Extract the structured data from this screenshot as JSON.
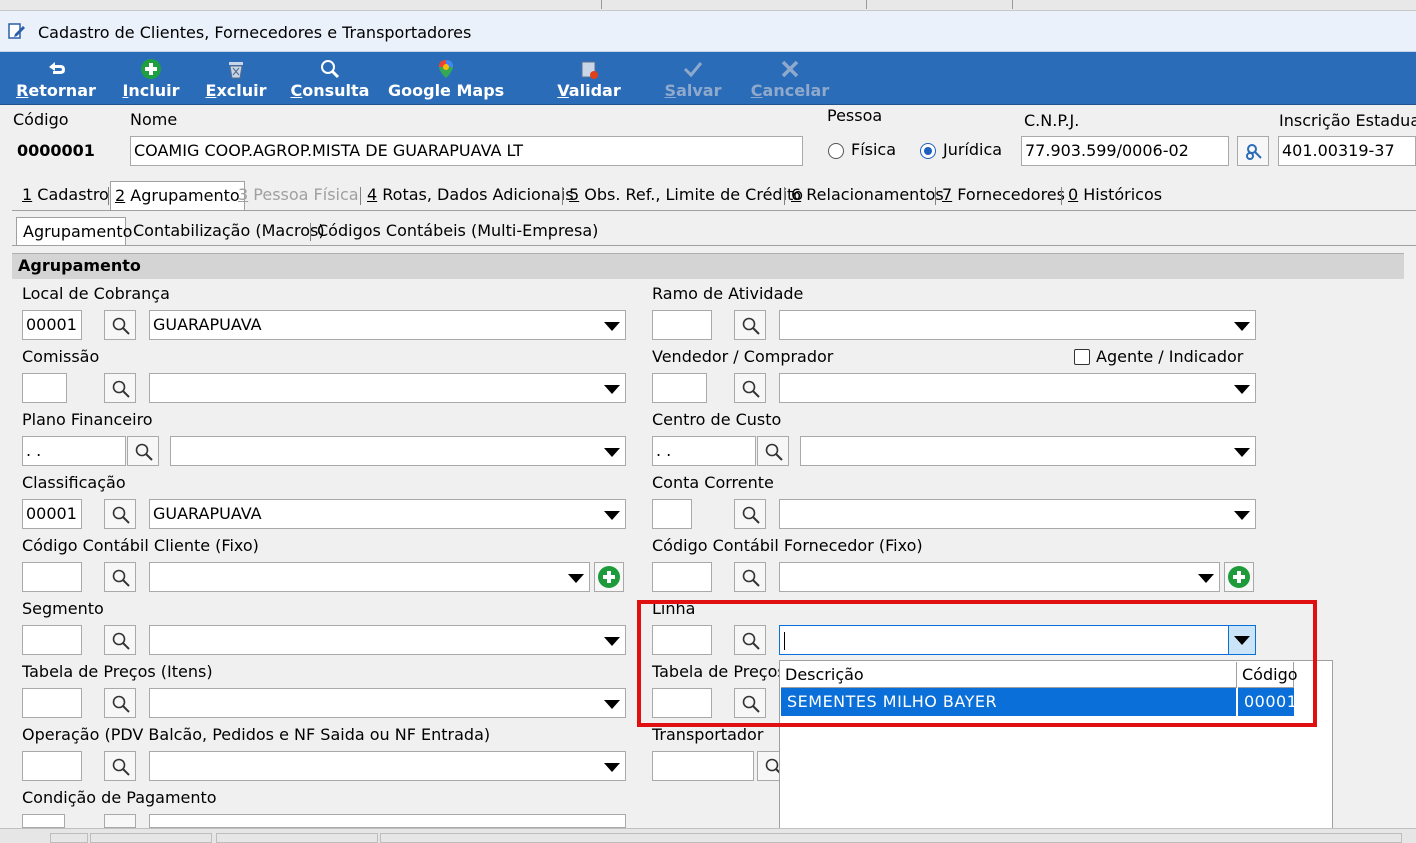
{
  "window": {
    "title": "Cadastro de Clientes, Fornecedores e Transportadores"
  },
  "toolbar": {
    "retornar": {
      "pre": "",
      "u": "R",
      "post": "etornar",
      "icon": "undo-arrow-icon"
    },
    "incluir": {
      "pre": "",
      "u": "I",
      "post": "ncluir",
      "icon": "plus-circle-icon"
    },
    "excluir": {
      "pre": "",
      "u": "E",
      "post": "xcluir",
      "icon": "trash-icon"
    },
    "consulta": {
      "pre": "",
      "u": "C",
      "post": "onsulta",
      "icon": "magnifier-icon"
    },
    "google_maps": {
      "pre": "Google Maps",
      "u": "",
      "post": "",
      "icon": "map-pin-icon"
    },
    "validar": {
      "pre": "",
      "u": "V",
      "post": "alidar",
      "icon": "validate-icon"
    },
    "salvar": {
      "pre": "",
      "u": "S",
      "post": "alvar",
      "icon": "checkmark-icon"
    },
    "cancelar": {
      "pre": "",
      "u": "C",
      "post": "ancelar",
      "icon": "x-icon"
    }
  },
  "header": {
    "codigo_label": "Código",
    "codigo_value": "0000001",
    "nome_label": "Nome",
    "nome_value": "COAMIG COOP.AGROP.MISTA DE GUARAPUAVA LT",
    "pessoa_label": "Pessoa",
    "fisica_label": "Física",
    "juridica_label": "Jurídica",
    "pessoa_selected": "Jurídica",
    "cnpj_label": "C.N.P.J.",
    "cnpj_value": "77.903.599/0006-02",
    "ie_label": "Inscrição Estadual",
    "ie_value": "401.00319-37"
  },
  "tabs": [
    {
      "u": "1",
      "rest": " Cadastro"
    },
    {
      "u": "2",
      "rest": " Agrupamento"
    },
    {
      "u": "3",
      "rest": " Pessoa Física"
    },
    {
      "u": "4",
      "rest": " Rotas, Dados Adicionais"
    },
    {
      "u": "5",
      "rest": " Obs. Ref., Limite de Crédito"
    },
    {
      "u": "6",
      "rest": " Relacionamentos"
    },
    {
      "u": "7",
      "rest": " Fornecedores"
    },
    {
      "u": "0",
      "rest": " Históricos"
    }
  ],
  "subtabs": [
    "Agrupamento",
    "Contabilização (Macros)",
    "Códigos Contábeis (Multi-Empresa)"
  ],
  "section_title": "Agrupamento",
  "left": {
    "local_cobranca": {
      "label": "Local de Cobrança",
      "code": "00001",
      "desc": "GUARAPUAVA"
    },
    "comissao": {
      "label": "Comissão",
      "code": "",
      "desc": ""
    },
    "plano_financeiro": {
      "label": "Plano Financeiro",
      "code": " .  .",
      "desc": ""
    },
    "classificacao": {
      "label": "Classificação",
      "code": "00001",
      "desc": "GUARAPUAVA"
    },
    "cod_contabil_cliente": {
      "label": "Código Contábil Cliente (Fixo)",
      "code": "",
      "desc": ""
    },
    "segmento": {
      "label": "Segmento",
      "code": "",
      "desc": ""
    },
    "tabela_precos_itens": {
      "label": "Tabela de Preços (Itens)",
      "code": "",
      "desc": ""
    },
    "operacao": {
      "label": "Operação (PDV Balcão, Pedidos e NF Saida ou NF Entrada)",
      "code": "",
      "desc": ""
    },
    "condicao_pagamento": {
      "label": "Condição de Pagamento"
    }
  },
  "right": {
    "ramo_atividade": {
      "label": "Ramo de Atividade",
      "code": "",
      "desc": ""
    },
    "vendedor": {
      "label": "Vendedor / Comprador",
      "code": "",
      "desc": ""
    },
    "agente_label": "Agente / Indicador",
    "centro_custo": {
      "label": "Centro de Custo",
      "code": " .  .",
      "desc": ""
    },
    "conta_corrente": {
      "label": "Conta Corrente",
      "code": "",
      "desc": ""
    },
    "cod_contabil_fornecedor": {
      "label": "Código Contábil Fornecedor (Fixo)",
      "code": "",
      "desc": ""
    },
    "linha": {
      "label": "Linha",
      "code": "",
      "desc": ""
    },
    "tabela_precos": {
      "label": "Tabela de Preços",
      "code": ""
    },
    "transportador": {
      "label": "Transportador",
      "code": ""
    }
  },
  "dropdown": {
    "col_descricao": "Descrição",
    "col_codigo": "Código",
    "rows": [
      {
        "descricao": "SEMENTES MILHO BAYER",
        "codigo": "00001"
      }
    ]
  }
}
